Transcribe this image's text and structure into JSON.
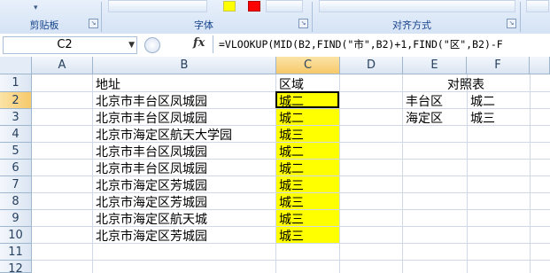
{
  "ribbon": {
    "groups": [
      "剪贴板",
      "字体",
      "对齐方式"
    ],
    "font_colors": {
      "highlight": "#ffff00",
      "font": "#ff0000"
    }
  },
  "formula_bar": {
    "name_box": "C2",
    "fx_label": "fx",
    "formula": "=VLOOKUP(MID(B2,FIND(\"市\",B2)+1,FIND(\"区\",B2)-F"
  },
  "sheet": {
    "columns": [
      "A",
      "B",
      "C",
      "D",
      "E",
      "F"
    ],
    "rows": [
      "1",
      "2",
      "3",
      "4",
      "5",
      "6",
      "7",
      "8",
      "9",
      "10",
      "11",
      "12"
    ],
    "b_header": "地址",
    "c_header": "区域",
    "addresses": [
      "北京市丰台区凤城园",
      "北京市丰台区凤城园",
      "北京市海定区航天大学园",
      "北京市丰台区凤城园",
      "北京市丰台区凤城园",
      "北京市海定区芳城园",
      "北京市海定区芳城园",
      "北京市海定区航天城",
      "北京市海定区芳城园"
    ],
    "regions": [
      "城二",
      "城二",
      "城三",
      "城二",
      "城二",
      "城三",
      "城三",
      "城三",
      "城三"
    ],
    "highlight_color": "#ffff00",
    "lookup": {
      "title": "对照表",
      "rows": [
        {
          "district": "丰台区",
          "zone": "城二"
        },
        {
          "district": "海定区",
          "zone": "城三"
        }
      ]
    }
  }
}
